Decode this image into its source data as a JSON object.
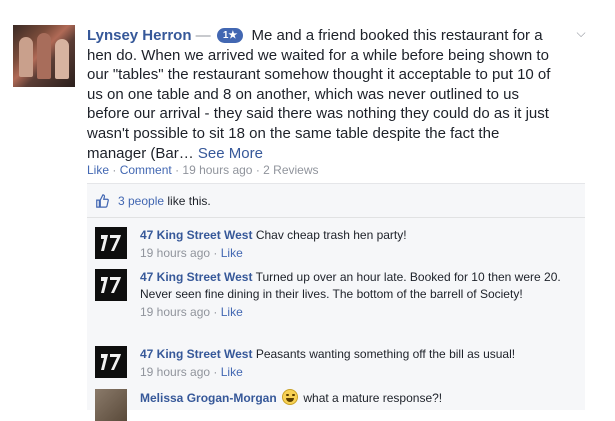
{
  "post": {
    "author": "Lynsey Herron",
    "dash": "—",
    "rating_badge": "1★",
    "text": "Me and a friend booked this restaurant for a hen do. When we arrived we waited for a while before being shown to our \"tables\" the restaurant somehow thought it acceptable to put 10 of us on one table and 8 on another, which was never outlined to us before our arrival - they said there was nothing they could do as it just wasn't possible to sit 18 on the same table despite the fact the manager (Bar…",
    "see_more": "See More",
    "actions": {
      "like": "Like",
      "comment": "Comment",
      "time": "19 hours ago",
      "reviews": "2 Reviews",
      "sep": "·"
    }
  },
  "likes": {
    "count": "3 people",
    "suffix": "like this."
  },
  "comments": [
    {
      "author": "47 King Street West",
      "text": "Chav cheap trash hen party!",
      "time": "19 hours ago",
      "like": "Like"
    },
    {
      "author": "47 King Street West",
      "text": "Turned up over an hour late. Booked for 10 then were 20. Never seen fine dining in their lives. The bottom of the barrell of Society!",
      "time": "19 hours ago",
      "like": "Like"
    },
    {
      "author": "47 King Street West",
      "text": "Peasants wanting something off the bill as usual!",
      "time": "19 hours ago",
      "like": "Like"
    },
    {
      "author": "Melissa Grogan-Morgan",
      "text": "what a mature response?!",
      "emoji": "grinning-emoji"
    }
  ],
  "colors": {
    "link": "#365899",
    "action": "#4267b2",
    "meta": "#90949c",
    "comment_bg": "#f6f7f9"
  }
}
